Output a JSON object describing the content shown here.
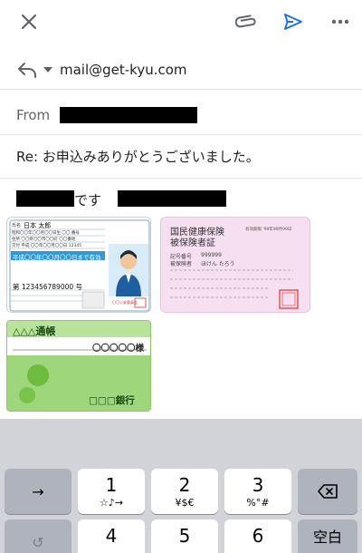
{
  "header": {
    "close_icon": "close-icon",
    "attach_icon": "paperclip-icon",
    "send_icon": "send-icon",
    "more_icon": "more-horizontal-icon"
  },
  "recipient": {
    "address": "mail@get-kyu.com"
  },
  "from": {
    "label": "From"
  },
  "subject": {
    "text": "Re: お申込みありがとうございました。"
  },
  "body": {
    "text": "です"
  },
  "license_card": {
    "name_label": "氏名",
    "name_value": "日本 太郎",
    "row2": "昭和〇〇年〇〇月〇〇日生 〇〇 番号",
    "row3": "住所 〇〇県〇〇市〇〇町 〇〇番地",
    "row4": "交付 平成 〇〇年〇〇月〇〇日 12345",
    "validity": "平成〇〇年〇〇月〇〇日まで有効",
    "number": "第 123456789000 号",
    "authority": "〇〇公安委員会"
  },
  "insurance_card": {
    "title_line1": "国民健康保険",
    "title_line2": "被保険者証",
    "expiry": "有効期限 '99年99月99日",
    "symbol_label": "記号番号",
    "symbol_value": "999999",
    "insured_label": "被保険者",
    "insured_value": "ほけん たろう"
  },
  "bankbook": {
    "title": "△△△通帳",
    "holder": "〇〇〇〇〇様",
    "bank": "□□□銀行"
  },
  "keyboard": {
    "keys": [
      {
        "main": "→",
        "sub": ""
      },
      {
        "main": "1",
        "sub": "☆♪→"
      },
      {
        "main": "2",
        "sub": "¥$€"
      },
      {
        "main": "3",
        "sub": "%°#"
      },
      {
        "main": "⌫",
        "sub": ""
      },
      {
        "main": "↺",
        "sub": ""
      },
      {
        "main": "4",
        "sub": ""
      },
      {
        "main": "5",
        "sub": ""
      },
      {
        "main": "6",
        "sub": ""
      },
      {
        "main": "空白",
        "sub": ""
      }
    ]
  },
  "colors": {
    "accent_blue": "#1a73e8",
    "text_gray": "#5f6368",
    "keyboard_bg": "#d1d3d9",
    "insurance_pink": "#f6dff0",
    "bankbook_green": "#9ed67b"
  }
}
